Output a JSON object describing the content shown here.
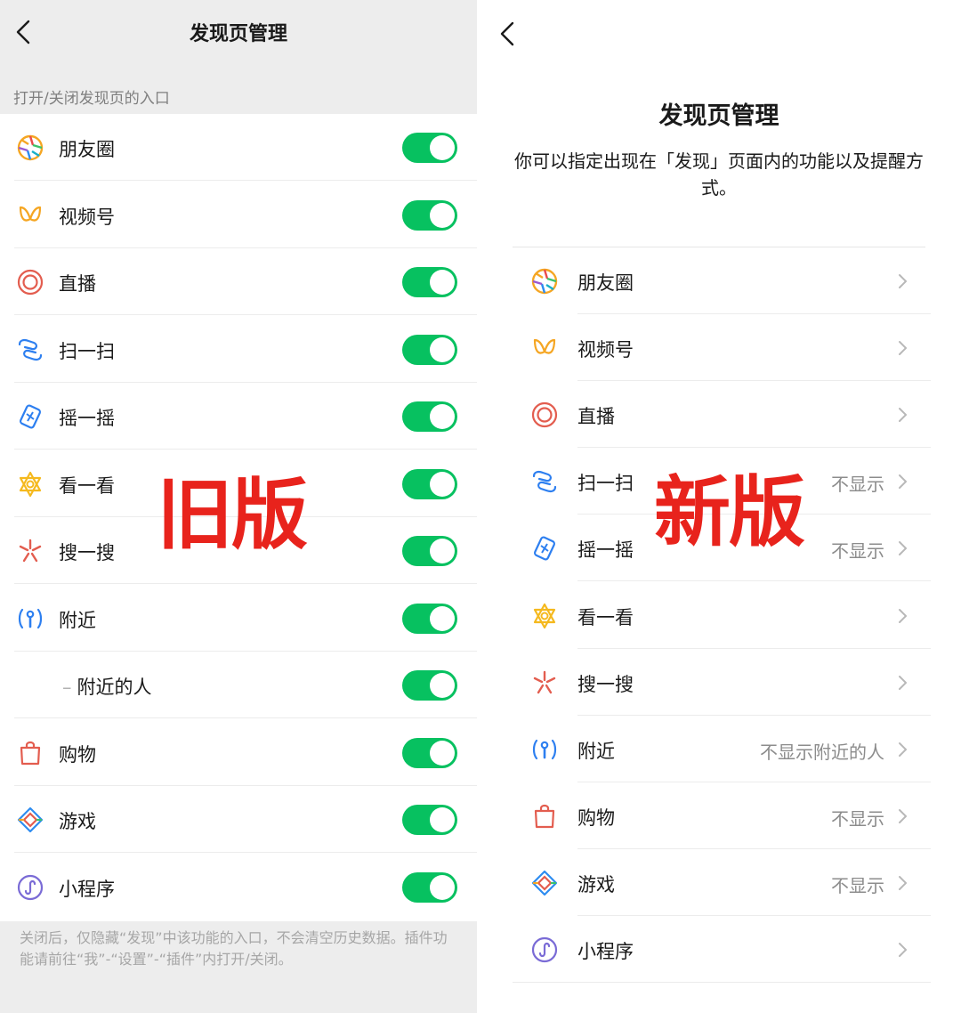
{
  "old": {
    "title": "发现页管理",
    "section_label": "打开/关闭发现页的入口",
    "items": [
      {
        "label": "朋友圈",
        "icon": "moments-icon",
        "enabled": true
      },
      {
        "label": "视频号",
        "icon": "channels-icon",
        "enabled": true
      },
      {
        "label": "直播",
        "icon": "live-icon",
        "enabled": true
      },
      {
        "label": "扫一扫",
        "icon": "scan-icon",
        "enabled": true
      },
      {
        "label": "摇一摇",
        "icon": "shake-icon",
        "enabled": true
      },
      {
        "label": "看一看",
        "icon": "top-stories-icon",
        "enabled": true
      },
      {
        "label": "搜一搜",
        "icon": "search-icon",
        "enabled": true
      },
      {
        "label": "附近",
        "icon": "nearby-icon",
        "enabled": true
      },
      {
        "label": "附近的人",
        "prefix": "–",
        "enabled": true
      },
      {
        "label": "购物",
        "icon": "shopping-icon",
        "enabled": true
      },
      {
        "label": "游戏",
        "icon": "games-icon",
        "enabled": true
      },
      {
        "label": "小程序",
        "icon": "mini-programs-icon",
        "enabled": true
      }
    ],
    "footer": "关闭后，仅隐藏“发现”中该功能的入口，不会清空历史数据。插件功能请前往“我”-“设置”-“插件”内打开/关闭。",
    "stamp": "旧版"
  },
  "new": {
    "title": "发现页管理",
    "description": "你可以指定出现在「发现」页面内的功能以及提醒方式。",
    "items": [
      {
        "label": "朋友圈",
        "icon": "moments-icon",
        "status": ""
      },
      {
        "label": "视频号",
        "icon": "channels-icon",
        "status": ""
      },
      {
        "label": "直播",
        "icon": "live-icon",
        "status": ""
      },
      {
        "label": "扫一扫",
        "icon": "scan-icon",
        "status": "不显示"
      },
      {
        "label": "摇一摇",
        "icon": "shake-icon",
        "status": "不显示"
      },
      {
        "label": "看一看",
        "icon": "top-stories-icon",
        "status": ""
      },
      {
        "label": "搜一搜",
        "icon": "search-icon",
        "status": ""
      },
      {
        "label": "附近",
        "icon": "nearby-icon",
        "status": "不显示附近的人"
      },
      {
        "label": "购物",
        "icon": "shopping-icon",
        "status": "不显示"
      },
      {
        "label": "游戏",
        "icon": "games-icon",
        "status": "不显示"
      },
      {
        "label": "小程序",
        "icon": "mini-programs-icon",
        "status": ""
      }
    ],
    "stamp": "新版"
  },
  "colors": {
    "toggle_on": "#07c160",
    "stamp_red": "#e8231c",
    "muted_text": "#8c8c8c"
  }
}
